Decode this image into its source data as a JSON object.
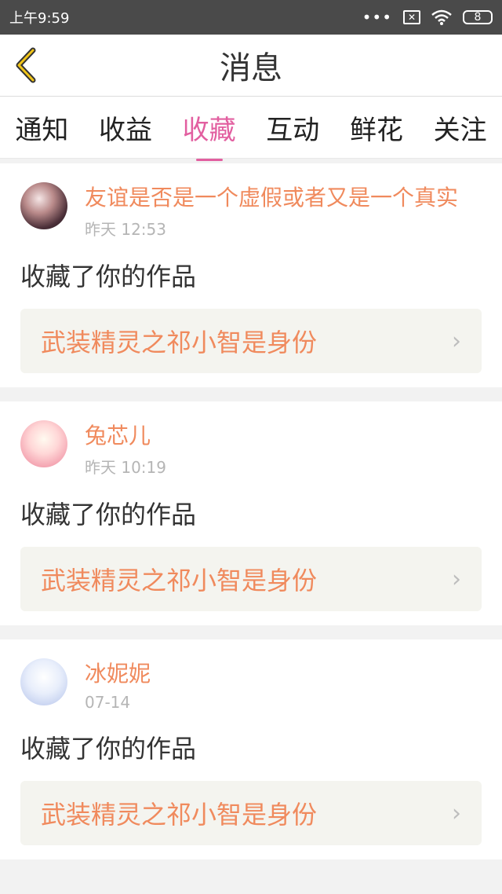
{
  "status_bar": {
    "time": "上午9:59",
    "dots": "•••",
    "sim_icon_text": "✕",
    "battery": "8"
  },
  "nav": {
    "title": "消息"
  },
  "tabs": [
    {
      "label": "通知"
    },
    {
      "label": "收益"
    },
    {
      "label": "收藏",
      "active": true
    },
    {
      "label": "互动"
    },
    {
      "label": "鲜花"
    },
    {
      "label": "关注"
    }
  ],
  "feed": [
    {
      "user": "友谊是否是一个虚假或者又是一个真实",
      "time": "昨天 12:53",
      "action": "收藏了你的作品",
      "work": "武装精灵之祁小智是身份"
    },
    {
      "user": "兔芯儿",
      "time": "昨天 10:19",
      "action": "收藏了你的作品",
      "work": "武装精灵之祁小智是身份"
    },
    {
      "user": "冰妮妮",
      "time": "07-14",
      "action": "收藏了你的作品",
      "work": "武装精灵之祁小智是身份"
    }
  ],
  "colors": {
    "accent_pink": "#e25fa0",
    "name_orange": "#f08a5d",
    "status_bar_bg": "#4a4a4a"
  },
  "icons": {
    "back": "chevron-left-icon",
    "row_arrow": "chevron-right-icon"
  }
}
